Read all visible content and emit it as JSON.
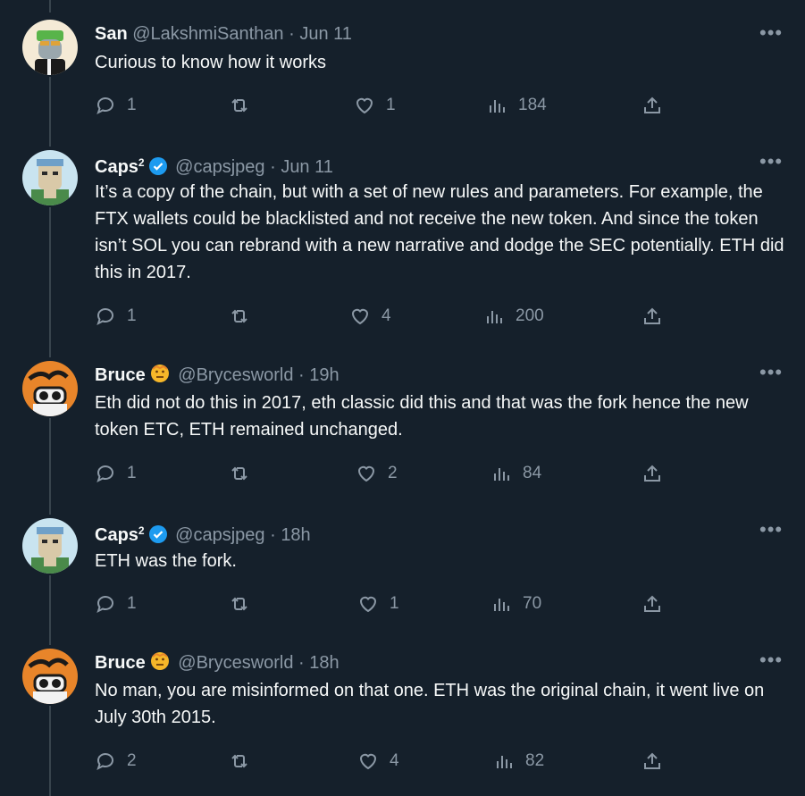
{
  "tweets": [
    {
      "name": "San",
      "name_sup": "",
      "verified": false,
      "emoji_badge": false,
      "handle": "@LakshmiSanthan",
      "date": "Jun 11",
      "text": "Curious to know how it works",
      "replies": "1",
      "retweets": "",
      "likes": "1",
      "views": "184"
    },
    {
      "name": "Caps",
      "name_sup": "2",
      "verified": true,
      "emoji_badge": false,
      "handle": "@capsjpeg",
      "date": "Jun 11",
      "text": "It’s a copy of the chain, but with a set of new rules and parameters. For example, the FTX wallets could be blacklisted and not receive the new token. And since the token isn’t SOL you can rebrand with a new narrative and dodge the SEC potentially. ETH did this in 2017.",
      "replies": "1",
      "retweets": "",
      "likes": "4",
      "views": "200"
    },
    {
      "name": "Bruce",
      "name_sup": "",
      "verified": false,
      "emoji_badge": true,
      "handle": "@Brycesworld",
      "date": "19h",
      "text": "Eth did not do this in 2017, eth classic did this and that was the fork hence the new token ETC, ETH remained unchanged.",
      "replies": "1",
      "retweets": "",
      "likes": "2",
      "views": "84"
    },
    {
      "name": "Caps",
      "name_sup": "2",
      "verified": true,
      "emoji_badge": false,
      "handle": "@capsjpeg",
      "date": "18h",
      "text": "ETH was the fork.",
      "replies": "1",
      "retweets": "",
      "likes": "1",
      "views": "70"
    },
    {
      "name": "Bruce",
      "name_sup": "",
      "verified": false,
      "emoji_badge": true,
      "handle": "@Brycesworld",
      "date": "18h",
      "text": "No man, you are misinformed on that one. ETH was the original chain, it went live on July 30th 2015.",
      "replies": "2",
      "retweets": "",
      "likes": "4",
      "views": "82"
    }
  ],
  "ui": {
    "separator": " · ",
    "more_glyph": "•••"
  },
  "colors": {
    "background": "#15202b",
    "text_primary": "#f7f9f9",
    "text_secondary": "#8b98a5",
    "verified_blue": "#1d9bf0",
    "thread_line": "#38444d"
  },
  "icons": [
    "reply-icon",
    "retweet-icon",
    "like-icon",
    "views-icon",
    "share-icon",
    "more-icon",
    "verified-badge-icon",
    "emoji-badge-icon"
  ]
}
